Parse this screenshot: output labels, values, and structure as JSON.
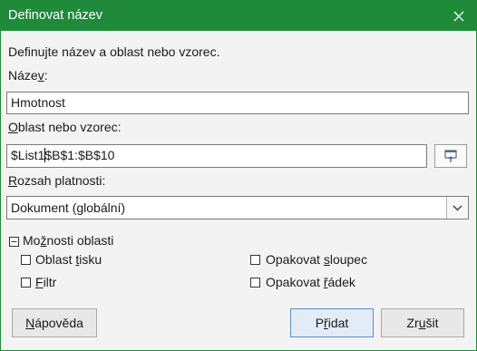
{
  "dialog": {
    "title": "Definovat název",
    "description": "Definujte název a oblast nebo vzorec.",
    "name_label_pre": "Náze",
    "name_label_accel": "v",
    "name_label_post": ":",
    "name_value": "Hmotnost",
    "range_label_accel": "O",
    "range_label_post": "blast nebo vzorec:",
    "range_value_before_caret": "$List1",
    "range_value_after_caret": "$B$1:$B$10",
    "scope_label_accel": "R",
    "scope_label_post": "ozsah platnosti:",
    "scope_value": "Dokument (globální)",
    "options_label_pre": "Mo",
    "options_label_accel": "ž",
    "options_label_post": "nosti oblasti",
    "options": {
      "print_range_pre": "Oblast ",
      "print_range_accel": "t",
      "print_range_post": "isku",
      "filter_accel": "F",
      "filter_post": "iltr",
      "repeat_column_pre": "Opakovat ",
      "repeat_column_accel": "s",
      "repeat_column_post": "loupec",
      "repeat_row_pre": "Opakovat ",
      "repeat_row_accel": "ř",
      "repeat_row_post": "ádek"
    },
    "buttons": {
      "help_accel": "N",
      "help_post": "ápověda",
      "add_pre": "P",
      "add_accel": "ř",
      "add_post": "idat",
      "cancel_pre": "Zr",
      "cancel_accel": "u",
      "cancel_post": "šit"
    }
  },
  "colors": {
    "titlebar": "#1f8a3a",
    "default_button": "#e3ecf6"
  },
  "icons": {
    "close": "close-icon",
    "shrink": "shrink-dialog-icon",
    "dropdown": "chevron-down-icon",
    "collapse": "minus-box-icon"
  }
}
